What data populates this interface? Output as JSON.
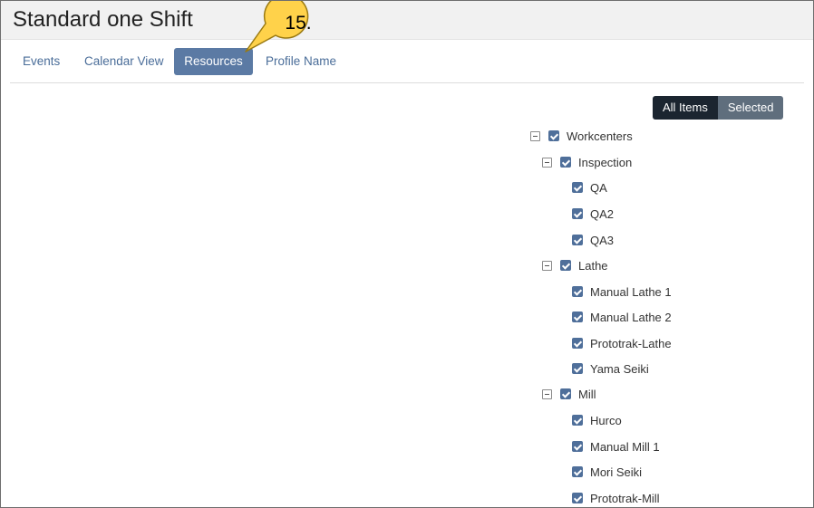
{
  "window": {
    "title": "Standard one Shift"
  },
  "tabs": [
    {
      "label": "Events"
    },
    {
      "label": "Calendar View"
    },
    {
      "label": "Resources"
    },
    {
      "label": "Profile Name"
    }
  ],
  "filter": {
    "all_label": "All Items",
    "selected_label": "Selected",
    "active": "All Items"
  },
  "tree": {
    "root": {
      "label": "Workcenters",
      "checked": true,
      "expanded": true
    },
    "groups": [
      {
        "label": "Inspection",
        "checked": true,
        "expanded": true,
        "items": [
          {
            "label": "QA"
          },
          {
            "label": "QA2"
          },
          {
            "label": "QA3"
          }
        ]
      },
      {
        "label": "Lathe",
        "checked": true,
        "expanded": true,
        "items": [
          {
            "label": "Manual Lathe 1"
          },
          {
            "label": "Manual Lathe 2"
          },
          {
            "label": "Prototrak-Lathe"
          },
          {
            "label": "Yama Seiki"
          }
        ]
      },
      {
        "label": "Mill",
        "checked": true,
        "expanded": true,
        "items": [
          {
            "label": "Hurco"
          },
          {
            "label": "Manual Mill 1"
          },
          {
            "label": "Mori Seiki"
          },
          {
            "label": "Prototrak-Mill"
          }
        ]
      }
    ]
  },
  "annotation": {
    "step": "15.",
    "fill": "#ffd24a",
    "stroke": "#9a7a12"
  }
}
